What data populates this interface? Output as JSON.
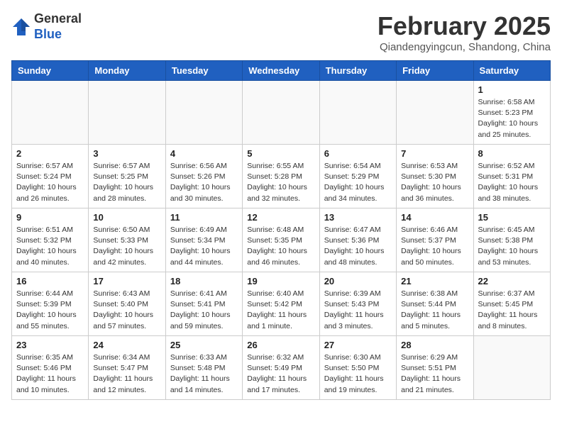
{
  "header": {
    "logo_line1": "General",
    "logo_line2": "Blue",
    "month_title": "February 2025",
    "location": "Qiandengyingcun, Shandong, China"
  },
  "days_of_week": [
    "Sunday",
    "Monday",
    "Tuesday",
    "Wednesday",
    "Thursday",
    "Friday",
    "Saturday"
  ],
  "weeks": [
    [
      {
        "day": "",
        "info": ""
      },
      {
        "day": "",
        "info": ""
      },
      {
        "day": "",
        "info": ""
      },
      {
        "day": "",
        "info": ""
      },
      {
        "day": "",
        "info": ""
      },
      {
        "day": "",
        "info": ""
      },
      {
        "day": "1",
        "info": "Sunrise: 6:58 AM\nSunset: 5:23 PM\nDaylight: 10 hours and 25 minutes."
      }
    ],
    [
      {
        "day": "2",
        "info": "Sunrise: 6:57 AM\nSunset: 5:24 PM\nDaylight: 10 hours and 26 minutes."
      },
      {
        "day": "3",
        "info": "Sunrise: 6:57 AM\nSunset: 5:25 PM\nDaylight: 10 hours and 28 minutes."
      },
      {
        "day": "4",
        "info": "Sunrise: 6:56 AM\nSunset: 5:26 PM\nDaylight: 10 hours and 30 minutes."
      },
      {
        "day": "5",
        "info": "Sunrise: 6:55 AM\nSunset: 5:28 PM\nDaylight: 10 hours and 32 minutes."
      },
      {
        "day": "6",
        "info": "Sunrise: 6:54 AM\nSunset: 5:29 PM\nDaylight: 10 hours and 34 minutes."
      },
      {
        "day": "7",
        "info": "Sunrise: 6:53 AM\nSunset: 5:30 PM\nDaylight: 10 hours and 36 minutes."
      },
      {
        "day": "8",
        "info": "Sunrise: 6:52 AM\nSunset: 5:31 PM\nDaylight: 10 hours and 38 minutes."
      }
    ],
    [
      {
        "day": "9",
        "info": "Sunrise: 6:51 AM\nSunset: 5:32 PM\nDaylight: 10 hours and 40 minutes."
      },
      {
        "day": "10",
        "info": "Sunrise: 6:50 AM\nSunset: 5:33 PM\nDaylight: 10 hours and 42 minutes."
      },
      {
        "day": "11",
        "info": "Sunrise: 6:49 AM\nSunset: 5:34 PM\nDaylight: 10 hours and 44 minutes."
      },
      {
        "day": "12",
        "info": "Sunrise: 6:48 AM\nSunset: 5:35 PM\nDaylight: 10 hours and 46 minutes."
      },
      {
        "day": "13",
        "info": "Sunrise: 6:47 AM\nSunset: 5:36 PM\nDaylight: 10 hours and 48 minutes."
      },
      {
        "day": "14",
        "info": "Sunrise: 6:46 AM\nSunset: 5:37 PM\nDaylight: 10 hours and 50 minutes."
      },
      {
        "day": "15",
        "info": "Sunrise: 6:45 AM\nSunset: 5:38 PM\nDaylight: 10 hours and 53 minutes."
      }
    ],
    [
      {
        "day": "16",
        "info": "Sunrise: 6:44 AM\nSunset: 5:39 PM\nDaylight: 10 hours and 55 minutes."
      },
      {
        "day": "17",
        "info": "Sunrise: 6:43 AM\nSunset: 5:40 PM\nDaylight: 10 hours and 57 minutes."
      },
      {
        "day": "18",
        "info": "Sunrise: 6:41 AM\nSunset: 5:41 PM\nDaylight: 10 hours and 59 minutes."
      },
      {
        "day": "19",
        "info": "Sunrise: 6:40 AM\nSunset: 5:42 PM\nDaylight: 11 hours and 1 minute."
      },
      {
        "day": "20",
        "info": "Sunrise: 6:39 AM\nSunset: 5:43 PM\nDaylight: 11 hours and 3 minutes."
      },
      {
        "day": "21",
        "info": "Sunrise: 6:38 AM\nSunset: 5:44 PM\nDaylight: 11 hours and 5 minutes."
      },
      {
        "day": "22",
        "info": "Sunrise: 6:37 AM\nSunset: 5:45 PM\nDaylight: 11 hours and 8 minutes."
      }
    ],
    [
      {
        "day": "23",
        "info": "Sunrise: 6:35 AM\nSunset: 5:46 PM\nDaylight: 11 hours and 10 minutes."
      },
      {
        "day": "24",
        "info": "Sunrise: 6:34 AM\nSunset: 5:47 PM\nDaylight: 11 hours and 12 minutes."
      },
      {
        "day": "25",
        "info": "Sunrise: 6:33 AM\nSunset: 5:48 PM\nDaylight: 11 hours and 14 minutes."
      },
      {
        "day": "26",
        "info": "Sunrise: 6:32 AM\nSunset: 5:49 PM\nDaylight: 11 hours and 17 minutes."
      },
      {
        "day": "27",
        "info": "Sunrise: 6:30 AM\nSunset: 5:50 PM\nDaylight: 11 hours and 19 minutes."
      },
      {
        "day": "28",
        "info": "Sunrise: 6:29 AM\nSunset: 5:51 PM\nDaylight: 11 hours and 21 minutes."
      },
      {
        "day": "",
        "info": ""
      }
    ]
  ]
}
